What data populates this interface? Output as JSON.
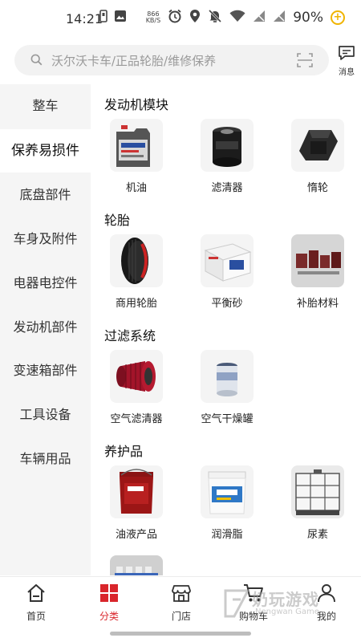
{
  "status_bar": {
    "time": "14:21",
    "net_speed_value": "866",
    "net_speed_unit": "KB/S",
    "battery": "90%",
    "icons": [
      "sim-icon",
      "image-icon",
      "alarm-icon",
      "location-icon",
      "mute-icon",
      "wifi-icon",
      "signal-1-icon",
      "signal-2-icon",
      "battery-saver-icon"
    ]
  },
  "search": {
    "placeholder": "沃尔沃卡车/正品轮胎/维修保养",
    "message_label": "消息"
  },
  "sidebar": {
    "items": [
      {
        "label": "整车"
      },
      {
        "label": "保养易损件"
      },
      {
        "label": "底盘部件"
      },
      {
        "label": "车身及附件"
      },
      {
        "label": "电器电控件"
      },
      {
        "label": "发动机部件"
      },
      {
        "label": "变速箱部件"
      },
      {
        "label": "工具设备"
      },
      {
        "label": "车辆用品"
      }
    ],
    "active_index": 1
  },
  "sections": [
    {
      "title": "发动机模块",
      "items": [
        {
          "label": "机油",
          "icon": "oil-bottle-image"
        },
        {
          "label": "滤清器",
          "icon": "oil-filter-image"
        },
        {
          "label": "惰轮",
          "icon": "idler-pulley-image"
        }
      ]
    },
    {
      "title": "轮胎",
      "items": [
        {
          "label": "商用轮胎",
          "icon": "tire-image"
        },
        {
          "label": "平衡砂",
          "icon": "balance-sand-box-image"
        },
        {
          "label": "补胎材料",
          "icon": "tire-patch-image"
        }
      ]
    },
    {
      "title": "过滤系统",
      "items": [
        {
          "label": "空气滤清器",
          "icon": "air-filter-image"
        },
        {
          "label": "空气干燥罐",
          "icon": "air-dryer-image"
        }
      ]
    },
    {
      "title": "养护品",
      "items": [
        {
          "label": "油液产品",
          "icon": "fluid-bucket-image"
        },
        {
          "label": "润滑脂",
          "icon": "grease-bucket-image"
        },
        {
          "label": "尿素",
          "icon": "urea-tank-image"
        }
      ]
    }
  ],
  "bottom_nav": {
    "tabs": [
      {
        "label": "首页",
        "icon": "home-icon"
      },
      {
        "label": "分类",
        "icon": "category-icon"
      },
      {
        "label": "门店",
        "icon": "store-icon"
      },
      {
        "label": "购物车",
        "icon": "cart-icon"
      },
      {
        "label": "我的",
        "icon": "profile-icon"
      }
    ],
    "active_index": 1
  },
  "watermark": {
    "main": "奶玩游戏",
    "sub": "Nengwan Game"
  },
  "colors": {
    "accent": "#d9252b",
    "sidebar_bg": "#f5f5f5",
    "search_bg": "#f2f2f2"
  }
}
